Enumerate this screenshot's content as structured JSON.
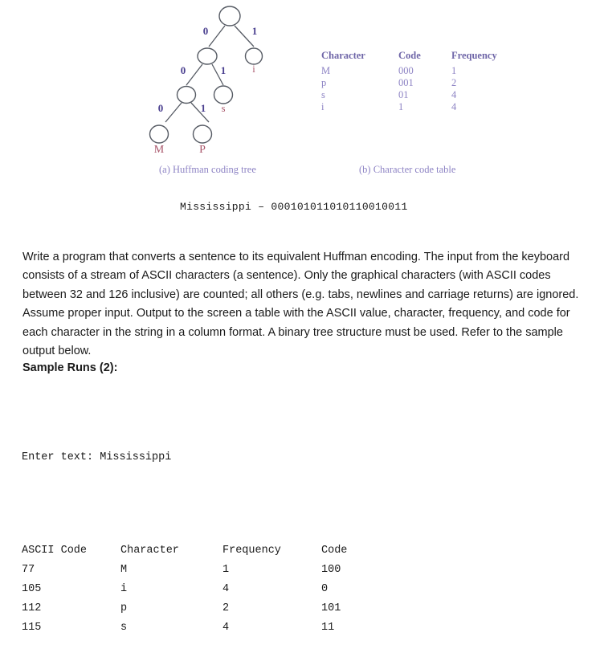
{
  "figure": {
    "tree": {
      "caption": "(a) Huffman coding tree",
      "edge_labels": [
        "0",
        "1",
        "0",
        "1",
        "0",
        "1"
      ],
      "leaf_labels": [
        "i",
        "s",
        "M",
        "P"
      ],
      "edge_label_color": "#4a3f8f",
      "leaf_label_color": "#a8556a",
      "node_stroke_color": "#555a63"
    },
    "table": {
      "caption": "(b) Character code table",
      "headers": [
        "Character",
        "Code",
        "Frequency"
      ],
      "rows": [
        {
          "character": "M",
          "code": "000",
          "frequency": "1"
        },
        {
          "character": "p",
          "code": "001",
          "frequency": "2"
        },
        {
          "character": "s",
          "code": "01",
          "frequency": "4"
        },
        {
          "character": "i",
          "code": "1",
          "frequency": "4"
        }
      ],
      "header_color": "#6f66a8",
      "body_color": "#8d83c4"
    }
  },
  "encoded_example": "Mississippi – 000101011010110010011",
  "problem_statement": "Write a program that converts a sentence to its equivalent Huffman encoding. The input from the keyboard consists of a stream of ASCII characters (a sentence). Only the graphical characters (with ASCII codes between 32 and 126 inclusive) are counted; all others (e.g. tabs, newlines and carriage returns) are ignored. Assume proper input.  Output to the screen a table with the ASCII value, character, frequency, and code for each character in the string in a column format. A binary tree structure must be used. Refer to the sample output below.",
  "sample_runs_heading": "Sample Runs (2):",
  "console": {
    "prompt": "Enter text: Mississippi",
    "headers": [
      "ASCII Code",
      "Character",
      "Frequency",
      "Code"
    ],
    "rows": [
      {
        "ascii": "77",
        "character": "M",
        "frequency": "1",
        "code": "100"
      },
      {
        "ascii": "105",
        "character": "i",
        "frequency": "4",
        "code": "0"
      },
      {
        "ascii": "112",
        "character": "p",
        "frequency": "2",
        "code": "101"
      },
      {
        "ascii": "115",
        "character": "s",
        "frequency": "4",
        "code": "11"
      }
    ]
  }
}
